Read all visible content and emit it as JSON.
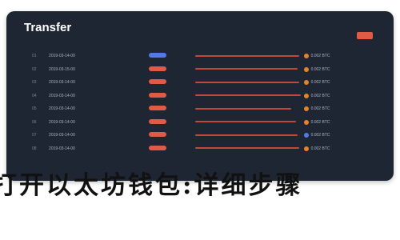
{
  "window": {
    "title": "Transfer"
  },
  "table": {
    "rows": [
      {
        "id": "01",
        "date": "2019-03-14-00",
        "status": "",
        "pill": "",
        "pill_color": "blue",
        "desc": "",
        "desc_width": 130,
        "amount": "0.002 BTC",
        "dot": "orange"
      },
      {
        "id": "02",
        "date": "2019-03-15-00",
        "status": "",
        "pill": "",
        "pill_color": "red",
        "desc": "",
        "desc_width": 128,
        "amount": "0.002 BTC",
        "dot": "orange"
      },
      {
        "id": "03",
        "date": "2019-03-14-00",
        "status": "",
        "pill": "",
        "pill_color": "red",
        "desc": "",
        "desc_width": 130,
        "amount": "0.002 BTC",
        "dot": "orange"
      },
      {
        "id": "04",
        "date": "2019-03-14-00",
        "status": "",
        "pill": "",
        "pill_color": "red",
        "desc": "",
        "desc_width": 132,
        "amount": "0.002 BTC",
        "dot": "orange"
      },
      {
        "id": "05",
        "date": "2019-03-14-00",
        "status": "",
        "pill": "",
        "pill_color": "red",
        "desc": "",
        "desc_width": 120,
        "amount": "0.002 BTC",
        "dot": "orange"
      },
      {
        "id": "06",
        "date": "2019-03-14-00",
        "status": "",
        "pill": "",
        "pill_color": "red",
        "desc": "",
        "desc_width": 126,
        "amount": "0.002 BTC",
        "dot": "orange"
      },
      {
        "id": "07",
        "date": "2019-03-14-00",
        "status": "",
        "pill": "",
        "pill_color": "red",
        "desc": "",
        "desc_width": 128,
        "amount": "0.002 BTC",
        "dot": "blue"
      },
      {
        "id": "08",
        "date": "2019-03-14-00",
        "status": "",
        "pill": "",
        "pill_color": "red",
        "desc": "",
        "desc_width": 130,
        "amount": "0.002 BTC",
        "dot": "orange"
      }
    ]
  },
  "overlay_caption": "打开以太坊钱包:详细步骤"
}
